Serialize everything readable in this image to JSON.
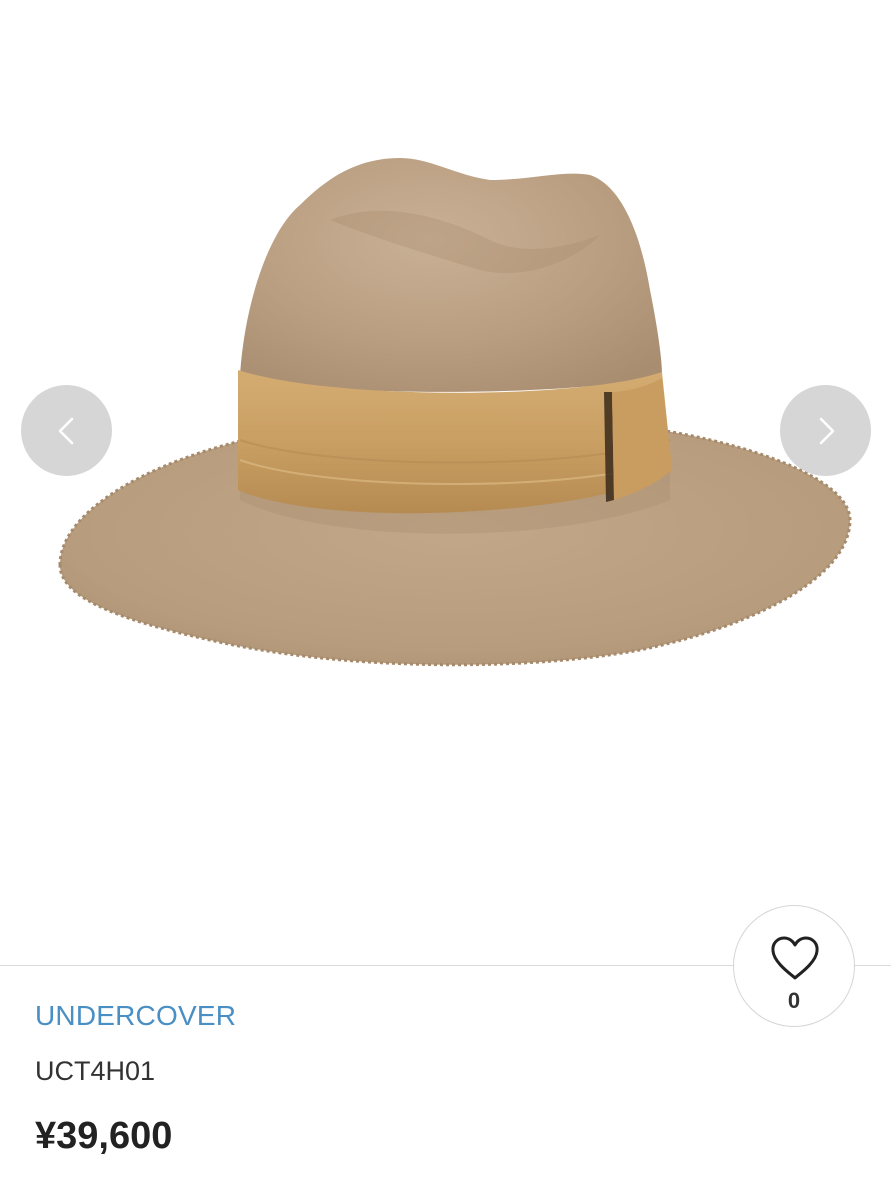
{
  "gallery": {
    "image_subject": "hat-photo",
    "prev_icon": "chevron-left-icon",
    "next_icon": "chevron-right-icon"
  },
  "favorite": {
    "icon": "heart-icon",
    "count": "0"
  },
  "product": {
    "brand": "UNDERCOVER",
    "sku": "UCT4H01",
    "price": "¥39,600"
  },
  "colors": {
    "brand_link": "#4a8fc4",
    "nav_button_bg": "#d6d6d6",
    "hat_felt": "#bba083",
    "hat_band": "#c9a066"
  }
}
